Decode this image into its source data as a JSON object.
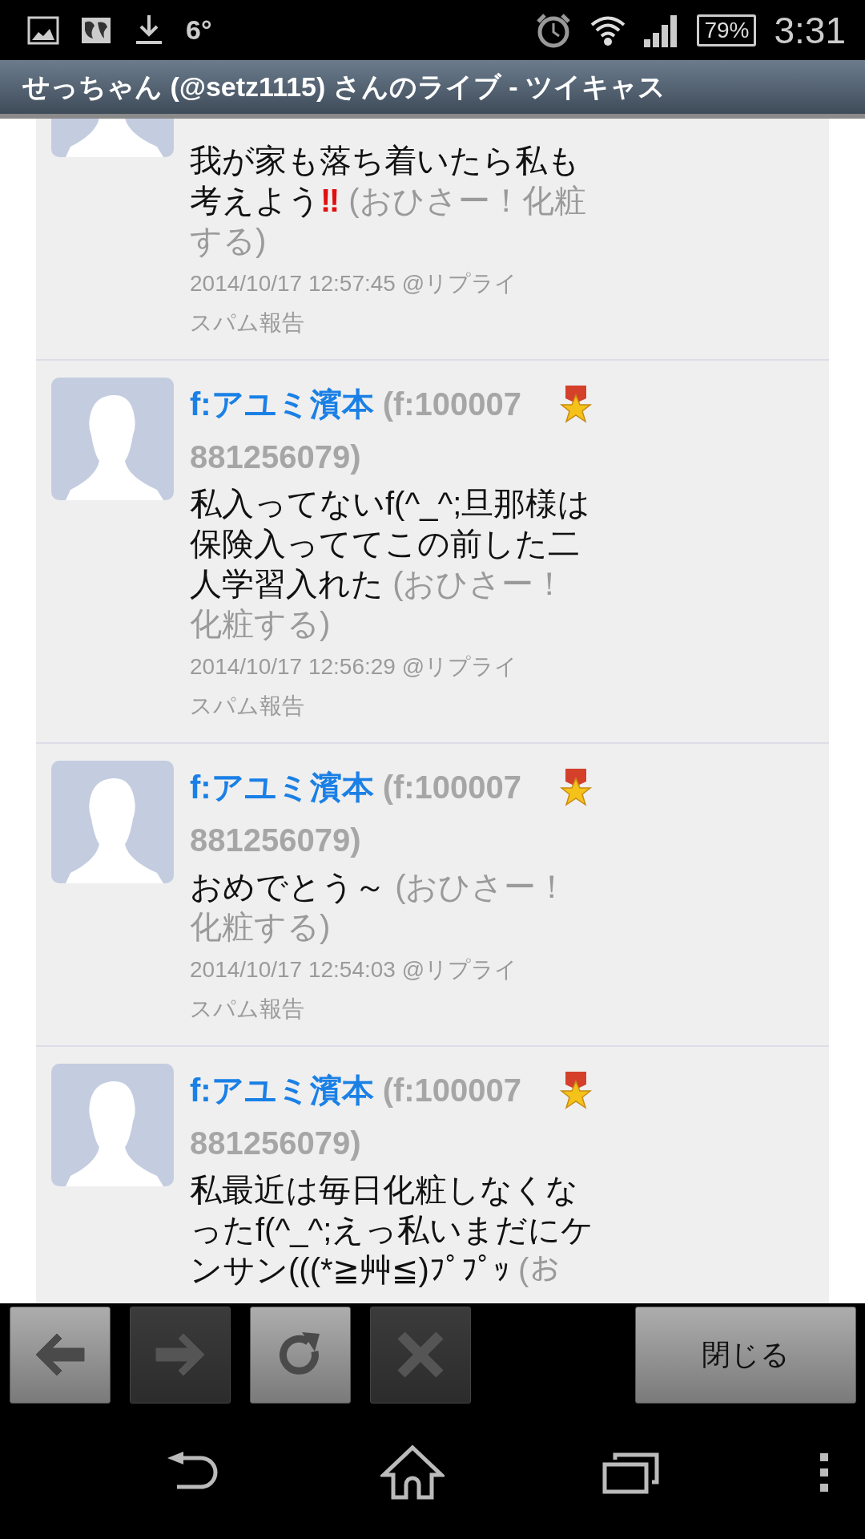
{
  "status_bar": {
    "temperature": "6°",
    "battery": "79%",
    "time": "3:31"
  },
  "title_bar": {
    "title": "せっちゃん (@setz1115) さんのライブ - ツイキャス"
  },
  "comments": [
    {
      "body": "我が家も落ち着いたら私も考えよう",
      "emoji": "‼",
      "note": "(おひさー！化粧する)",
      "time": "2014/10/17 12:57:45",
      "reply": "@リプライ",
      "spam": "スパム報告"
    },
    {
      "user": "f:アユミ濱本",
      "user_id": [
        "(f:100007",
        "881256079)"
      ],
      "badge": true,
      "body": "私入ってないf(^_^;旦那様は保険入っててこの前した二人学習入れた",
      "note": "(おひさー！化粧する)",
      "time": "2014/10/17 12:56:29",
      "reply": "@リプライ",
      "spam": "スパム報告"
    },
    {
      "user": "f:アユミ濱本",
      "user_id": [
        "(f:100007",
        "881256079)"
      ],
      "badge": true,
      "body": "おめでとう～",
      "note": "(おひさー！化粧する)",
      "time": "2014/10/17 12:54:03",
      "reply": "@リプライ",
      "spam": "スパム報告"
    },
    {
      "user": "f:アユミ濱本",
      "user_id": [
        "(f:100007",
        "881256079)"
      ],
      "badge": true,
      "body": "私最近は毎日化粧しなくなったf(^_^;えっ私いまだにケンサン(((*≧艸≦)ﾌﾟﾌﾟｯ",
      "note": "(お"
    }
  ],
  "toolbar": {
    "buttons": [
      {
        "kind": "back",
        "disabled": false
      },
      {
        "kind": "forward",
        "disabled": true
      },
      {
        "kind": "reload",
        "disabled": false
      },
      {
        "kind": "stop",
        "disabled": true
      }
    ],
    "close": "閉じる"
  }
}
